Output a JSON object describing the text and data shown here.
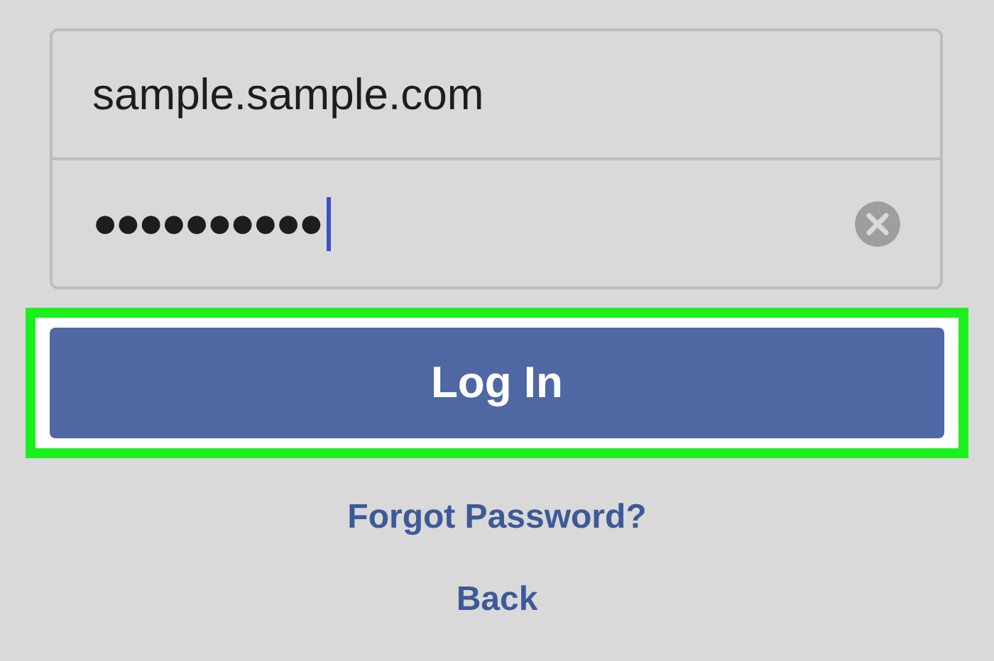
{
  "fields": [
    {
      "kind": "text",
      "value": "sample.sample.com",
      "focused": false,
      "clearable": false
    },
    {
      "kind": "password",
      "value": "●●●●●●●●●●",
      "focused": true,
      "clearable": true
    }
  ],
  "login_button": {
    "label": "Log In",
    "highlighted": true
  },
  "links": [
    "Forgot Password?",
    "Back"
  ]
}
